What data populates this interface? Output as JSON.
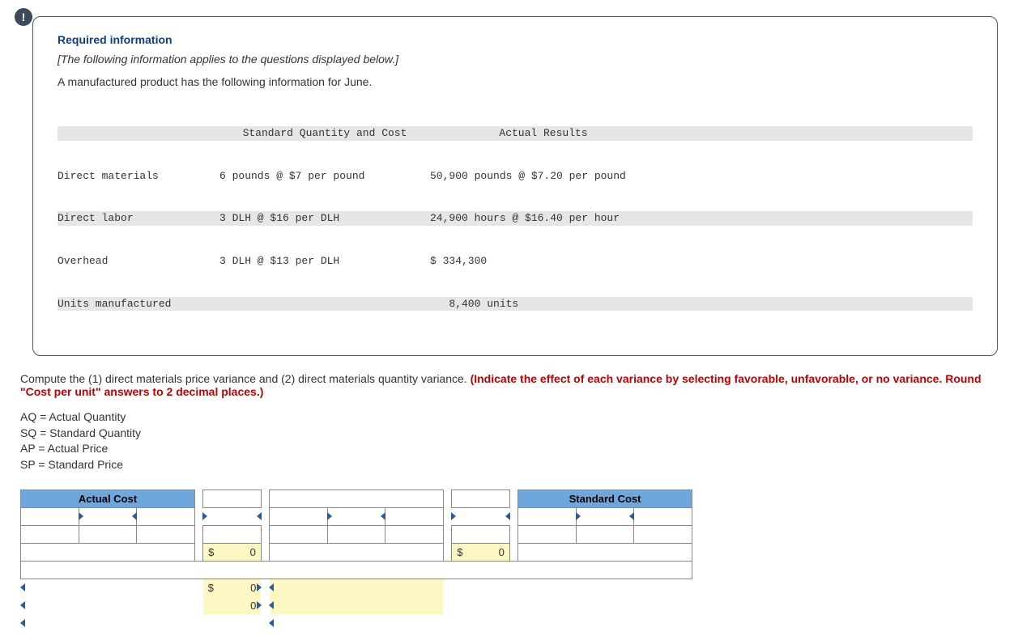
{
  "info": {
    "req_title": "Required information",
    "applies": "[The following information applies to the questions displayed below.]",
    "intro": "A manufactured product has the following information for June.",
    "std_hdr": "Standard Quantity and Cost",
    "act_hdr": "Actual Results",
    "rows": [
      {
        "label": "Direct materials",
        "std": "6 pounds @ $7 per pound",
        "act": "50,900 pounds @ $7.20 per pound"
      },
      {
        "label": "Direct labor",
        "std": "3 DLH @ $16 per DLH",
        "act": "24,900 hours @ $16.40 per hour"
      },
      {
        "label": "Overhead",
        "std": "3 DLH @ $13 per DLH",
        "act": "$ 334,300"
      },
      {
        "label": "Units manufactured",
        "std": "",
        "act": "   8,400 units"
      }
    ]
  },
  "question": {
    "p1": "Compute the (1) direct materials price variance and (2) direct materials quantity variance. ",
    "p1_red": "(Indicate the effect of each variance by selecting favorable, unfavorable, or no variance. Round \"Cost per unit\" answers to 2 decimal places.)",
    "defs": [
      "AQ = Actual Quantity",
      "SQ = Standard Quantity",
      "AP = Actual Price",
      "SP = Standard Price"
    ]
  },
  "table": {
    "actual_cost_hdr": "Actual Cost",
    "standard_cost_hdr": "Standard Cost",
    "val_left": "0",
    "val_mid": "0",
    "val_var1": "0",
    "val_var2": "0"
  }
}
